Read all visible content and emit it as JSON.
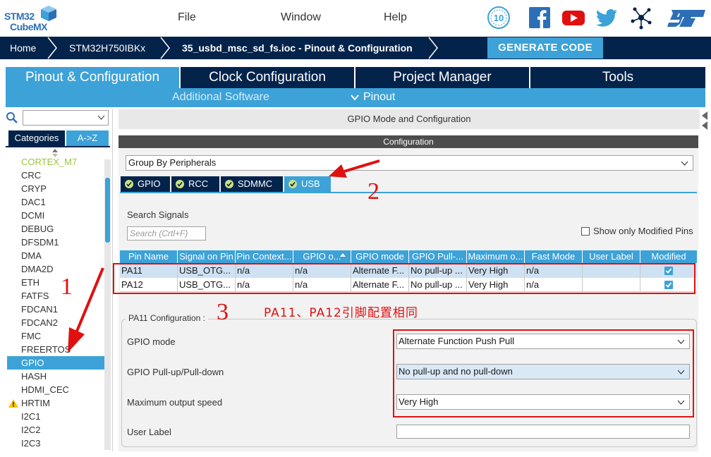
{
  "app": {
    "logo_line1": "STM32",
    "logo_line2": "CubeMX",
    "menu": [
      "File",
      "Window",
      "Help"
    ],
    "icons": [
      "anniversary-badge-icon",
      "facebook-icon",
      "youtube-icon",
      "twitter-icon",
      "network-icon",
      "st-logo-icon"
    ],
    "badge_number": "10"
  },
  "breadcrumb": {
    "home": "Home",
    "device": "STM32H750IBKx",
    "project": "35_usbd_msc_sd_fs.ioc - Pinout & Configuration",
    "generate": "GENERATE CODE"
  },
  "main_tabs": [
    "Pinout & Configuration",
    "Clock Configuration",
    "Project Manager",
    "Tools"
  ],
  "sub_tabs": {
    "additional": "Additional Software",
    "pinout": "Pinout"
  },
  "left": {
    "tab_categories": "Categories",
    "tab_az": "A->Z",
    "peripherals": [
      "CORTEX_M7",
      "CRC",
      "CRYP",
      "DAC1",
      "DCMI",
      "DEBUG",
      "DFSDM1",
      "DMA",
      "DMA2D",
      "ETH",
      "FATFS",
      "FDCAN1",
      "FDCAN2",
      "FMC",
      "FREERTOS",
      "GPIO",
      "HASH",
      "HDMI_CEC",
      "HRTIM",
      "I2C1",
      "I2C2",
      "I2C3"
    ],
    "selected": "GPIO",
    "warning_item": "HRTIM"
  },
  "panel": {
    "title": "GPIO Mode and Configuration",
    "config_header": "Configuration",
    "group_by": "Group By Peripherals",
    "peripheral_tabs": [
      "GPIO",
      "RCC",
      "SDMMC",
      "USB"
    ],
    "active_tab": "USB",
    "search_label": "Search Signals",
    "search_placeholder": "Search (Crtl+F)",
    "show_modified": "Show only Modified Pins"
  },
  "table": {
    "headers": [
      "Pin Name",
      "Signal on Pin",
      "Pin Context...",
      "GPIO o...",
      "GPIO mode",
      "GPIO Pull-...",
      "Maximum o...",
      "Fast Mode",
      "User Label",
      "Modified"
    ],
    "rows": [
      [
        "PA11",
        "USB_OTG...",
        "n/a",
        "n/a",
        "Alternate F...",
        "No pull-up ...",
        "Very High",
        "n/a",
        "",
        true
      ],
      [
        "PA12",
        "USB_OTG...",
        "n/a",
        "n/a",
        "Alternate F...",
        "No pull-up ...",
        "Very High",
        "n/a",
        "",
        true
      ]
    ]
  },
  "pin_config": {
    "legend": "PA11 Configuration :",
    "gpio_mode_label": "GPIO mode",
    "gpio_mode_value": "Alternate Function Push Pull",
    "pull_label": "GPIO Pull-up/Pull-down",
    "pull_value": "No pull-up and no pull-down",
    "speed_label": "Maximum output speed",
    "speed_value": "Very High",
    "user_label": "User Label"
  },
  "annotations": {
    "n1": "1",
    "n2": "2",
    "n3": "3",
    "note": "PA11、PA12引脚配置相同"
  },
  "colors": {
    "navy": "#03234b",
    "accent": "#3ca2d8",
    "annotation_red": "#e01010"
  }
}
